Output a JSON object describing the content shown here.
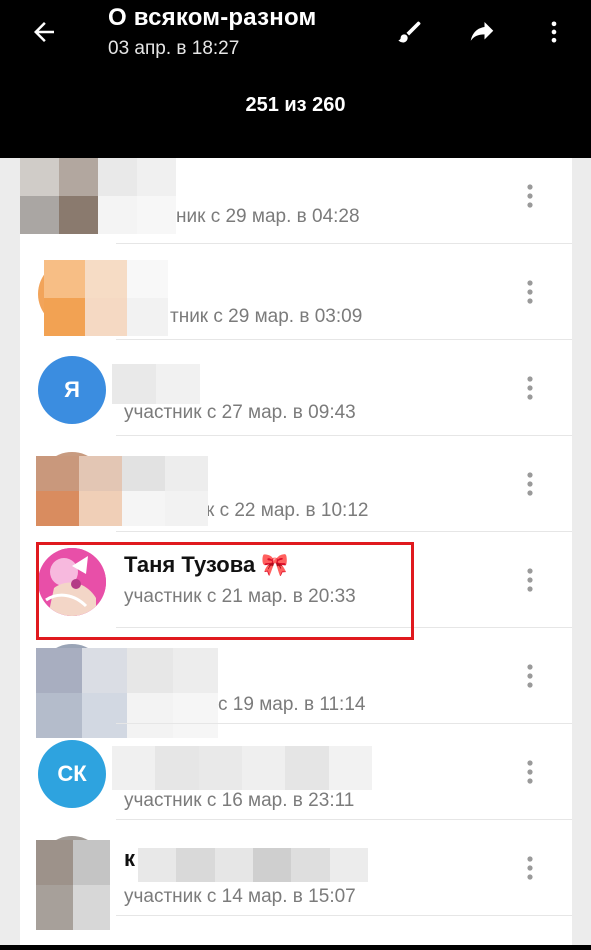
{
  "header": {
    "title": "О всяком-разном",
    "subtitle": "03 апр. в 18:27",
    "counter": "251 из 260"
  },
  "icons": {
    "back": "arrow-left-icon",
    "edit": "brush-icon",
    "share": "share-icon",
    "menu": "more-vertical-icon"
  },
  "members": [
    {
      "name": "",
      "meta": "ник с 29 мар. в 04:28",
      "avatar_text": "",
      "avatar_color": "#222222",
      "obscured": true
    },
    {
      "name": "",
      "meta": "тник с 29 мар. в 03:09",
      "avatar_text": "",
      "avatar_color": "#f2a45a",
      "obscured": true
    },
    {
      "name": "",
      "meta": "участник с 27 мар. в 09:43",
      "avatar_text": "Я",
      "avatar_color": "#3b8de0",
      "obscured": true
    },
    {
      "name": "",
      "meta": "к с 22 мар. в 10:12",
      "avatar_text": "",
      "avatar_color": "#c89b80",
      "obscured": true
    },
    {
      "name": "Таня Тузова 🎀",
      "meta": "участник с 21 мар. в 20:33",
      "avatar_text": "",
      "avatar_color": "#e84fa8",
      "obscured": false
    },
    {
      "name": "",
      "meta": "с 19 мар. в 11:14",
      "avatar_text": "",
      "avatar_color": "#9aa4b6",
      "obscured": true
    },
    {
      "name": "",
      "meta": "участник с 16 мар. в 23:11",
      "avatar_text": "СК",
      "avatar_color": "#2ea3df",
      "obscured": true
    },
    {
      "name": "к",
      "meta": "участник с 14 мар. в 15:07",
      "avatar_text": "",
      "avatar_color": "#a19b96",
      "obscured": true
    }
  ],
  "colors": {
    "accent_highlight": "#e0191e",
    "meta_text": "#7b7b7b"
  }
}
